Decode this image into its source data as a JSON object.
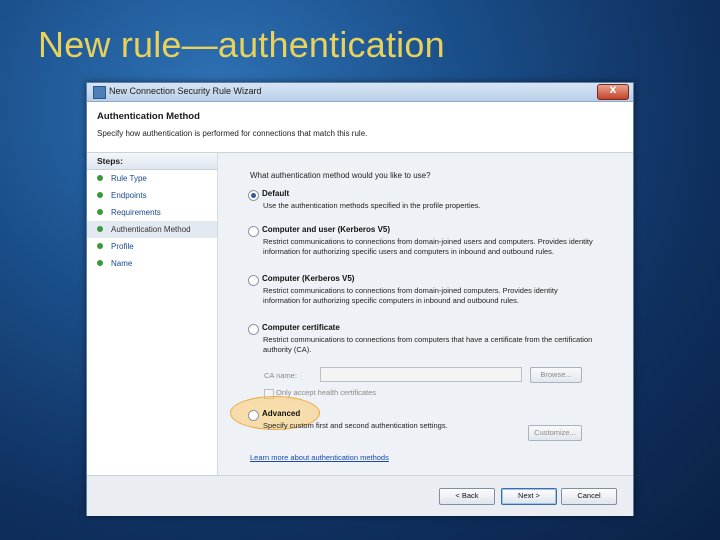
{
  "slide": {
    "title": "New rule—authentication"
  },
  "window": {
    "title": "New Connection Security Rule Wizard",
    "close_glyph": "X"
  },
  "header": {
    "title": "Authentication Method",
    "description": "Specify how authentication is performed for connections that match this rule."
  },
  "steps": {
    "heading": "Steps:",
    "items": [
      {
        "label": "Rule Type"
      },
      {
        "label": "Endpoints"
      },
      {
        "label": "Requirements"
      },
      {
        "label": "Authentication Method",
        "active": true
      },
      {
        "label": "Profile"
      },
      {
        "label": "Name"
      }
    ]
  },
  "content": {
    "question": "What authentication method would you like to use?",
    "options": [
      {
        "label": "Default",
        "checked": true,
        "description": "Use the authentication methods specified in the profile properties."
      },
      {
        "label": "Computer and user (Kerberos V5)",
        "checked": false,
        "description": "Restrict communications to connections from domain-joined users and computers. Provides identity information for authorizing specific users and computers in inbound and outbound rules."
      },
      {
        "label": "Computer (Kerberos V5)",
        "checked": false,
        "description": "Restrict communications to connections from domain-joined computers. Provides identity information for authorizing specific computers in inbound and outbound rules."
      },
      {
        "label": "Computer certificate",
        "checked": false,
        "description": "Restrict communications to connections from computers that have a certificate from the certification authority (CA)."
      },
      {
        "label": "Advanced",
        "checked": false,
        "description": "Specify custom first and second authentication settings."
      }
    ],
    "ca_label": "CA name:",
    "ca_value": "",
    "browse_label": "Browse...",
    "health_checkbox_label": "Only accept health certificates",
    "customize_label": "Customize...",
    "learn_more": "Learn more about authentication methods"
  },
  "footer": {
    "back": "< Back",
    "next": "Next >",
    "cancel": "Cancel"
  },
  "colors": {
    "title": "#e8d25a",
    "highlight": "#f0a93a",
    "link": "#1a4ab0"
  }
}
